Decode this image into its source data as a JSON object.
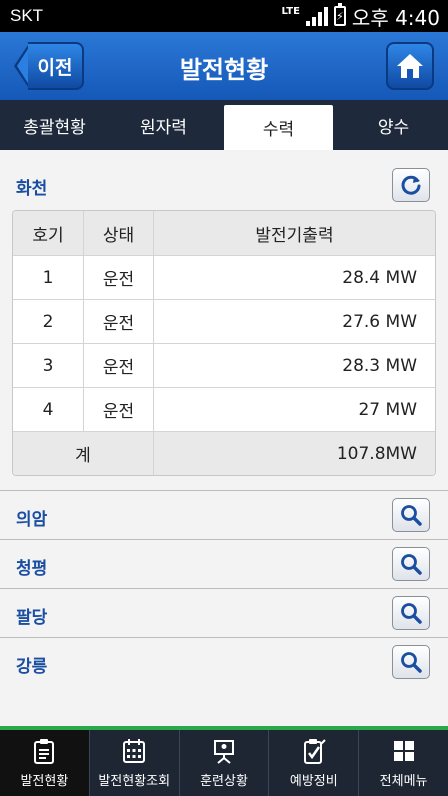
{
  "status_bar": {
    "carrier": "SKT",
    "network": "LTE",
    "time": "오후 4:40"
  },
  "header": {
    "back_label": "이전",
    "title": "발전현황",
    "home_icon": "home-icon"
  },
  "tabs": [
    {
      "label": "총괄현황",
      "active": false
    },
    {
      "label": "원자력",
      "active": false
    },
    {
      "label": "수력",
      "active": true
    },
    {
      "label": "양수",
      "active": false
    }
  ],
  "station": {
    "name": "화천",
    "refresh_icon": "refresh-icon",
    "columns": [
      "호기",
      "상태",
      "발전기출력"
    ],
    "rows": [
      {
        "unit": "1",
        "status": "운전",
        "output": "28.4 MW"
      },
      {
        "unit": "2",
        "status": "운전",
        "output": "27.6 MW"
      },
      {
        "unit": "3",
        "status": "운전",
        "output": "28.3 MW"
      },
      {
        "unit": "4",
        "status": "운전",
        "output": "27 MW"
      }
    ],
    "total_label": "계",
    "total_value": "107.8MW"
  },
  "other_stations": [
    {
      "name": "의암"
    },
    {
      "name": "청평"
    },
    {
      "name": "팔당"
    },
    {
      "name": "강릉"
    }
  ],
  "bottom_nav": [
    {
      "label": "발전현황",
      "icon": "clipboard-icon",
      "active": true
    },
    {
      "label": "발전현황조회",
      "icon": "calendar-icon",
      "active": false
    },
    {
      "label": "훈련상황",
      "icon": "presentation-icon",
      "active": false
    },
    {
      "label": "예방정비",
      "icon": "checklist-icon",
      "active": false
    },
    {
      "label": "전체메뉴",
      "icon": "grid-icon",
      "active": false
    }
  ],
  "colors": {
    "header_blue": "#1f66c8",
    "tab_bar": "#1e2a3c",
    "station_text": "#1a4ea0",
    "nav_accent": "#2aa94a"
  }
}
